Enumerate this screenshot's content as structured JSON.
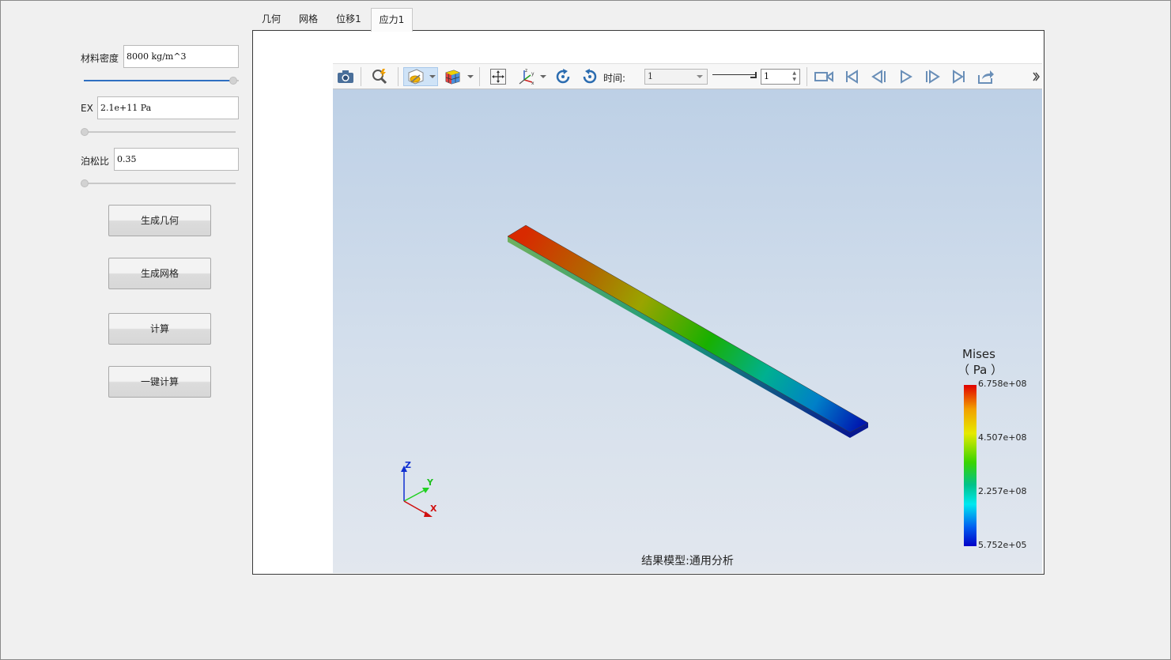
{
  "left_panel": {
    "density": {
      "label": "材料密度",
      "value": "8000 kg/m^3",
      "slider_fraction": 1.0
    },
    "ex": {
      "label": "EX",
      "value": "2.1e+11 Pa",
      "slider_fraction": 0.0
    },
    "poisson": {
      "label": "泊松比",
      "value": "0.35",
      "slider_fraction": 0.0
    },
    "buttons": {
      "generate_geometry": "生成几何",
      "generate_mesh": "生成网格",
      "compute": "计算",
      "one_click_compute": "一键计算"
    }
  },
  "tabs": [
    {
      "label": "几何",
      "active": false
    },
    {
      "label": "网格",
      "active": false
    },
    {
      "label": "位移1",
      "active": false
    },
    {
      "label": "应力1",
      "active": true
    }
  ],
  "toolbar": {
    "icons": [
      "camera-icon",
      "zoom-fit-icon",
      "display-mode-icon",
      "color-cube-icon",
      "pan-icon",
      "axis-view-icon",
      "rotate-cw-icon",
      "rotate-ccw-icon",
      "video-record-icon",
      "first-frame-icon",
      "prev-frame-icon",
      "play-icon",
      "next-frame-icon",
      "last-frame-icon",
      "export-icon"
    ],
    "time_label": "时间:",
    "time_value": "1",
    "frame_value": "1"
  },
  "viewport": {
    "legend": {
      "title": "Mises",
      "unit": "（ Pa ）",
      "ticks": [
        "6.758e+08",
        "4.507e+08",
        "2.257e+08",
        "5.752e+05"
      ]
    },
    "axes": {
      "x": "X",
      "y": "Y",
      "z": "Z"
    },
    "status": "结果模型:通用分析"
  },
  "colors": {
    "accent": "#2f6fc1",
    "viewport_top": "#bdd0e6",
    "viewport_bottom": "#e2e7ee"
  }
}
